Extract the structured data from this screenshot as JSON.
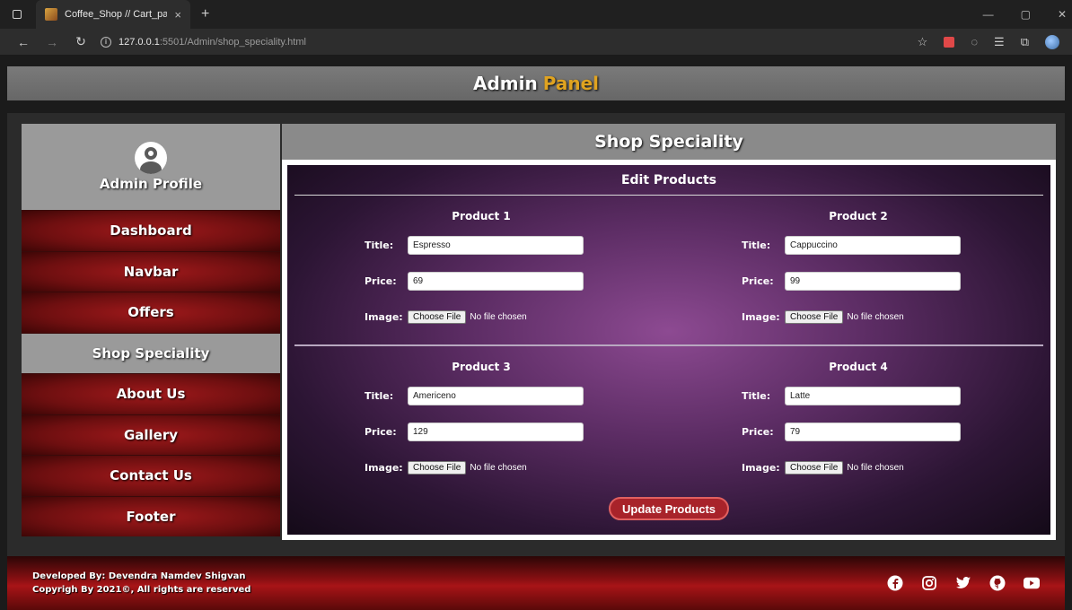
{
  "browser": {
    "tab_title": "Coffee_Shop // Cart_page",
    "tab_close": "×",
    "new_tab": "+",
    "url_host": "127.0.0.1",
    "url_path": ":5501/Admin/shop_speciality.html",
    "controls": {
      "minimize": "—",
      "restore": "▢",
      "close": "✕"
    }
  },
  "header": {
    "title_main": "Admin",
    "title_accent": "Panel",
    "accent_color": "#e0a320"
  },
  "sidebar": {
    "profile_label": "Admin Profile",
    "items": [
      {
        "label": "Dashboard",
        "active": false
      },
      {
        "label": "Navbar",
        "active": false
      },
      {
        "label": "Offers",
        "active": false
      },
      {
        "label": "Shop Speciality",
        "active": true
      },
      {
        "label": "About Us",
        "active": false
      },
      {
        "label": "Gallery",
        "active": false
      },
      {
        "label": "Contact Us",
        "active": false
      },
      {
        "label": "Footer",
        "active": false
      }
    ]
  },
  "content": {
    "title": "Shop Speciality",
    "form_heading": "Edit Products",
    "labels": {
      "title": "Title:",
      "price": "Price:",
      "image": "Image:"
    },
    "file_button": "Choose File",
    "file_status": "No file chosen",
    "products": [
      {
        "heading": "Product 1",
        "title": "Espresso",
        "price": "69"
      },
      {
        "heading": "Product 2",
        "title": "Cappuccino",
        "price": "99"
      },
      {
        "heading": "Product 3",
        "title": "Americeno",
        "price": "129"
      },
      {
        "heading": "Product 4",
        "title": "Latte",
        "price": "79"
      }
    ],
    "update_button": "Update Products"
  },
  "footer": {
    "line1": "Developed By: Devendra Namdev Shigvan",
    "line2": "Copyrigh By 2021©, All rights are reserved",
    "social_icons": [
      "facebook-icon",
      "instagram-icon",
      "twitter-icon",
      "github-icon",
      "youtube-icon"
    ]
  }
}
